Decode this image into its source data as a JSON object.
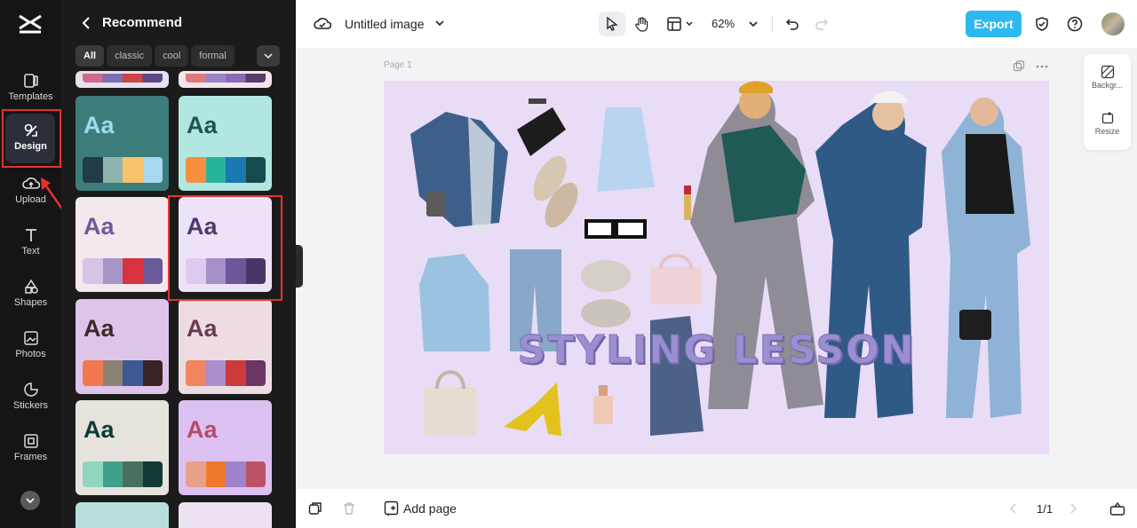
{
  "sidebar": {
    "items": [
      {
        "label": "Templates",
        "icon": "templates-icon"
      },
      {
        "label": "Design",
        "icon": "design-icon"
      },
      {
        "label": "Upload",
        "icon": "upload-icon"
      },
      {
        "label": "Text",
        "icon": "text-icon"
      },
      {
        "label": "Shapes",
        "icon": "shapes-icon"
      },
      {
        "label": "Photos",
        "icon": "photos-icon"
      },
      {
        "label": "Stickers",
        "icon": "stickers-icon"
      },
      {
        "label": "Frames",
        "icon": "frames-icon"
      }
    ],
    "active": "Design"
  },
  "panel": {
    "title": "Recommend",
    "chips": [
      "All",
      "classic",
      "cool",
      "formal"
    ],
    "card_label": "Aa",
    "palettes": [
      {
        "bg": "#3c7d7c",
        "aa": "#a5d8ec",
        "swatches": [
          "#233a47",
          "#8db5ad",
          "#f8c26b",
          "#a8d8ef"
        ]
      },
      {
        "bg": "#b2e6e1",
        "aa": "#1f5554",
        "swatches": [
          "#f4903e",
          "#26b59a",
          "#1b78b0",
          "#174a4c"
        ]
      },
      {
        "bg": "#f3e8ee",
        "aa": "#6b5d9a",
        "swatches": [
          "#d6c4e5",
          "#a794c7",
          "#d8333f",
          "#6a5a97"
        ]
      },
      {
        "bg": "#eee2f8",
        "aa": "#4a3d6e",
        "swatches": [
          "#dccbee",
          "#a690c9",
          "#6b589a",
          "#463866"
        ]
      },
      {
        "bg": "#dfc4e9",
        "aa": "#3a2a2c",
        "swatches": [
          "#f2794f",
          "#8b8276",
          "#3c5a91",
          "#3a2325"
        ]
      },
      {
        "bg": "#eddde3",
        "aa": "#6b3b55",
        "swatches": [
          "#f2845e",
          "#a98ed0",
          "#cc3b3b",
          "#6b3562"
        ]
      },
      {
        "bg": "#e5e3dc",
        "aa": "#0e3a33",
        "swatches": [
          "#8fd6be",
          "#3ea28a",
          "#49705f",
          "#123a34"
        ]
      },
      {
        "bg": "#dcc1f2",
        "aa": "#b54b6b",
        "swatches": [
          "#e8a08a",
          "#f07a2b",
          "#9f83cc",
          "#bb5266"
        ]
      }
    ]
  },
  "topbar": {
    "doc_title": "Untitled image",
    "zoom": "62%",
    "export_label": "Export"
  },
  "canvas": {
    "page_label": "Page 1",
    "headline": "STYLING LESSON"
  },
  "right_tools": {
    "background_label": "Backgr...",
    "resize_label": "Resize"
  },
  "bottombar": {
    "add_page_label": "Add page",
    "page_indicator": "1/1"
  }
}
